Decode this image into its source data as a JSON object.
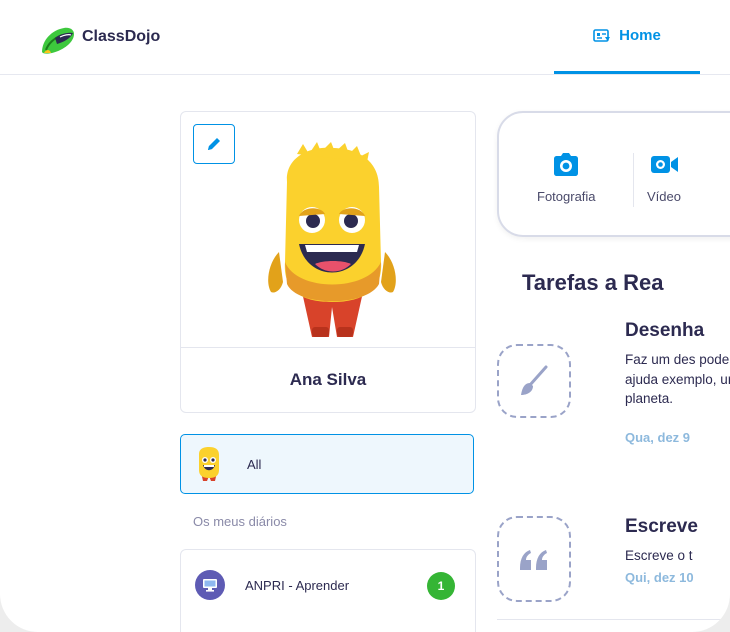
{
  "brand": {
    "name": "ClassDojo"
  },
  "nav": {
    "home_label": "Home",
    "home_icon": "newsfeed-icon"
  },
  "profile": {
    "name": "Ana Silva",
    "edit_icon": "pencil-icon"
  },
  "filter": {
    "all_label": "All"
  },
  "journals": {
    "section_label": "Os meus diários",
    "items": [
      {
        "name": "ANPRI - Aprender",
        "count": "1"
      }
    ]
  },
  "post_options": [
    {
      "label": "Fotografia",
      "icon": "camera-icon"
    },
    {
      "label": "Vídeo",
      "icon": "video-camera-icon"
    }
  ],
  "tasks": {
    "title": "Tarefas a Rea",
    "items": [
      {
        "title": "Desenha",
        "description": " Faz um des pode ajuda exemplo, ur um planeta.",
        "date": "Qua, dez 9",
        "icon": "paintbrush-icon"
      },
      {
        "title": "Escreve",
        "description": " Escreve o t",
        "date": "Qui, dez 10",
        "icon": "quote-icon"
      }
    ]
  },
  "colors": {
    "accent": "#0092e5",
    "text": "#2c2a50",
    "badge": "#35b535",
    "date": "#8db9dd"
  }
}
